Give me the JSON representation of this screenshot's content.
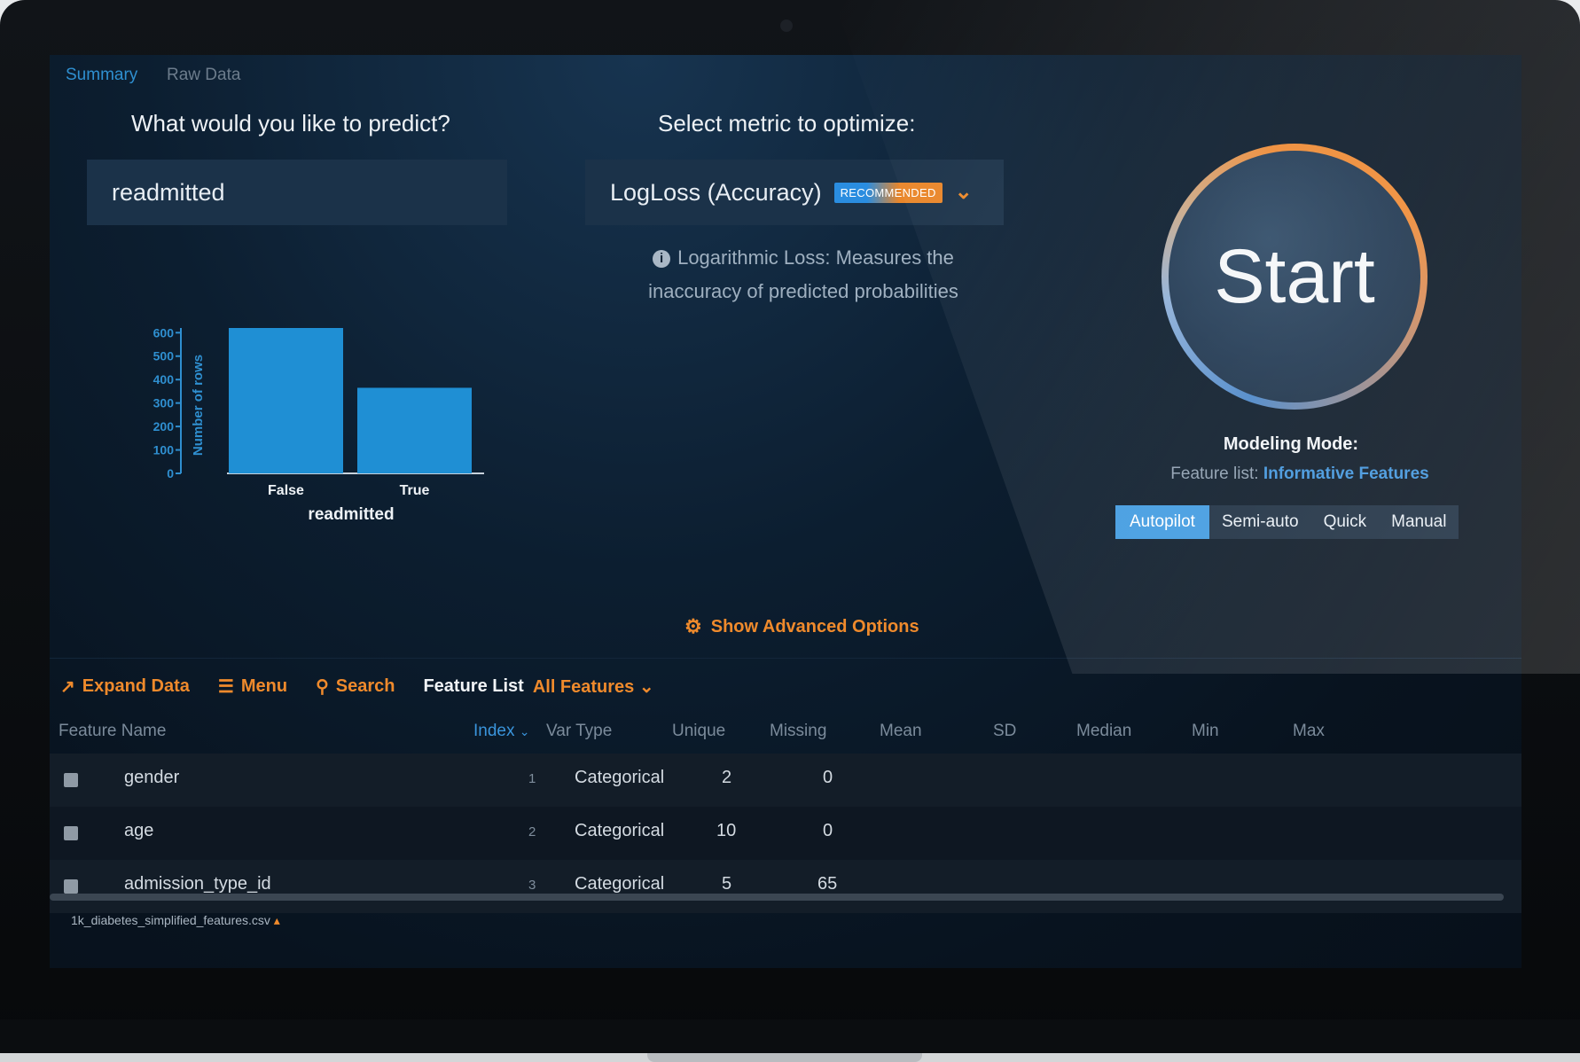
{
  "tabs": [
    {
      "label": "Summary",
      "active": true
    },
    {
      "label": "Raw Data",
      "active": false
    }
  ],
  "target": {
    "question": "What would you like to predict?",
    "value": "readmitted"
  },
  "metric": {
    "question": "Select metric to optimize:",
    "value": "LogLoss (Accuracy)",
    "badge": "RECOMMENDED",
    "description": "Logarithmic Loss: Measures the inaccuracy of predicted probabilities"
  },
  "start": {
    "label": "Start",
    "modeling_mode_title": "Modeling Mode:",
    "feature_list_label": "Feature list:",
    "feature_list_value": "Informative Features",
    "modes": [
      "Autopilot",
      "Semi-auto",
      "Quick",
      "Manual"
    ],
    "active_mode": "Autopilot"
  },
  "advanced_options_label": "Show Advanced Options",
  "toolbar": {
    "expand": "Expand Data",
    "menu": "Menu",
    "search": "Search",
    "feature_list_label": "Feature List",
    "feature_list_value": "All Features"
  },
  "table": {
    "columns": [
      "Feature Name",
      "Index",
      "Var Type",
      "Unique",
      "Missing",
      "Mean",
      "SD",
      "Median",
      "Min",
      "Max"
    ],
    "sorted_column": "Index",
    "rows": [
      {
        "name": "gender",
        "index": "1",
        "type": "Categorical",
        "unique": "2",
        "missing": "0"
      },
      {
        "name": "age",
        "index": "2",
        "type": "Categorical",
        "unique": "10",
        "missing": "0"
      },
      {
        "name": "admission_type_id",
        "index": "3",
        "type": "Categorical",
        "unique": "5",
        "missing": "65"
      }
    ]
  },
  "file_tab": "1k_diabetes_simplified_features.csv",
  "colors": {
    "accent_orange": "#ef8a2c",
    "accent_blue": "#3f94dc"
  },
  "chart_data": {
    "type": "bar",
    "categories": [
      "False",
      "True"
    ],
    "values": [
      620,
      365
    ],
    "xlabel": "readmitted",
    "ylabel": "Number of rows",
    "yticks": [
      0,
      100,
      200,
      300,
      400,
      500,
      600
    ],
    "ylim": [
      0,
      620
    ]
  }
}
